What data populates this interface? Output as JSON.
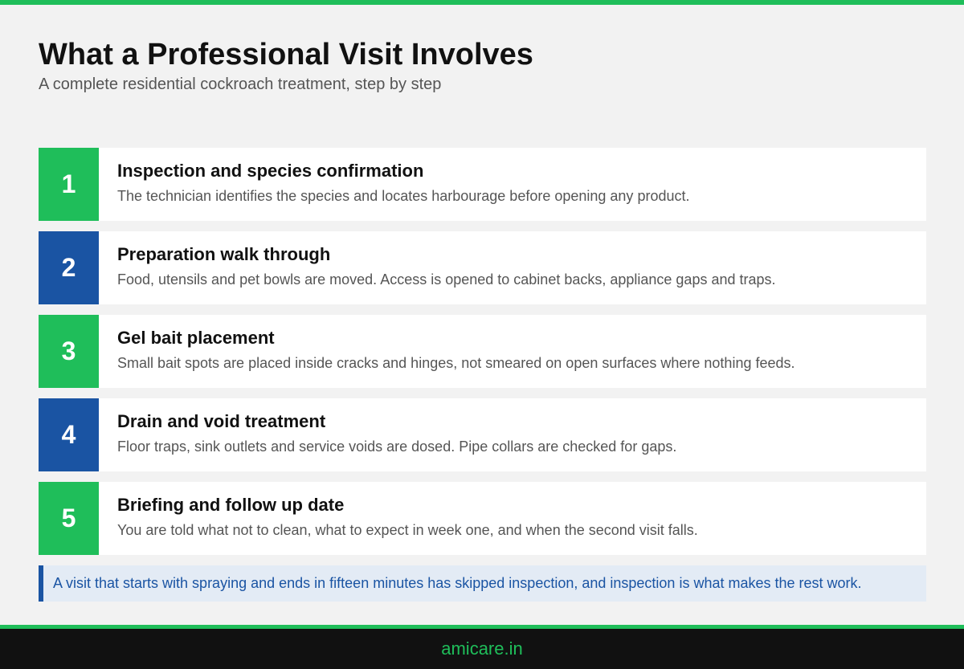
{
  "header": {
    "title": "What a Professional Visit Involves",
    "subtitle": "A complete residential cockroach treatment, step by step"
  },
  "steps": [
    {
      "number": "1",
      "title": "Inspection and species confirmation",
      "description": "The technician identifies the species and locates harbourage before opening any product.",
      "accent": "#1fbe5a"
    },
    {
      "number": "2",
      "title": "Preparation walk through",
      "description": "Food, utensils and pet bowls are moved. Access is opened to cabinet backs, appliance gaps and traps.",
      "accent": "#1a54a3"
    },
    {
      "number": "3",
      "title": "Gel bait placement",
      "description": "Small bait spots are placed inside cracks and hinges, not smeared on open surfaces where nothing feeds.",
      "accent": "#1fbe5a"
    },
    {
      "number": "4",
      "title": "Drain and void treatment",
      "description": "Floor traps, sink outlets and service voids are dosed. Pipe collars are checked for gaps.",
      "accent": "#1a54a3"
    },
    {
      "number": "5",
      "title": "Briefing and follow up date",
      "description": "You are told what not to clean, what to expect in week one, and when the second visit falls.",
      "accent": "#1fbe5a"
    }
  ],
  "callout": {
    "text": "A visit that starts with spraying and ends in fifteen minutes has skipped inspection, and inspection is what makes the rest work."
  },
  "footer": {
    "brand": "amicare.in"
  },
  "colors": {
    "green": "#1fbe5a",
    "blue": "#1a54a3",
    "footer_bg": "#111111"
  }
}
